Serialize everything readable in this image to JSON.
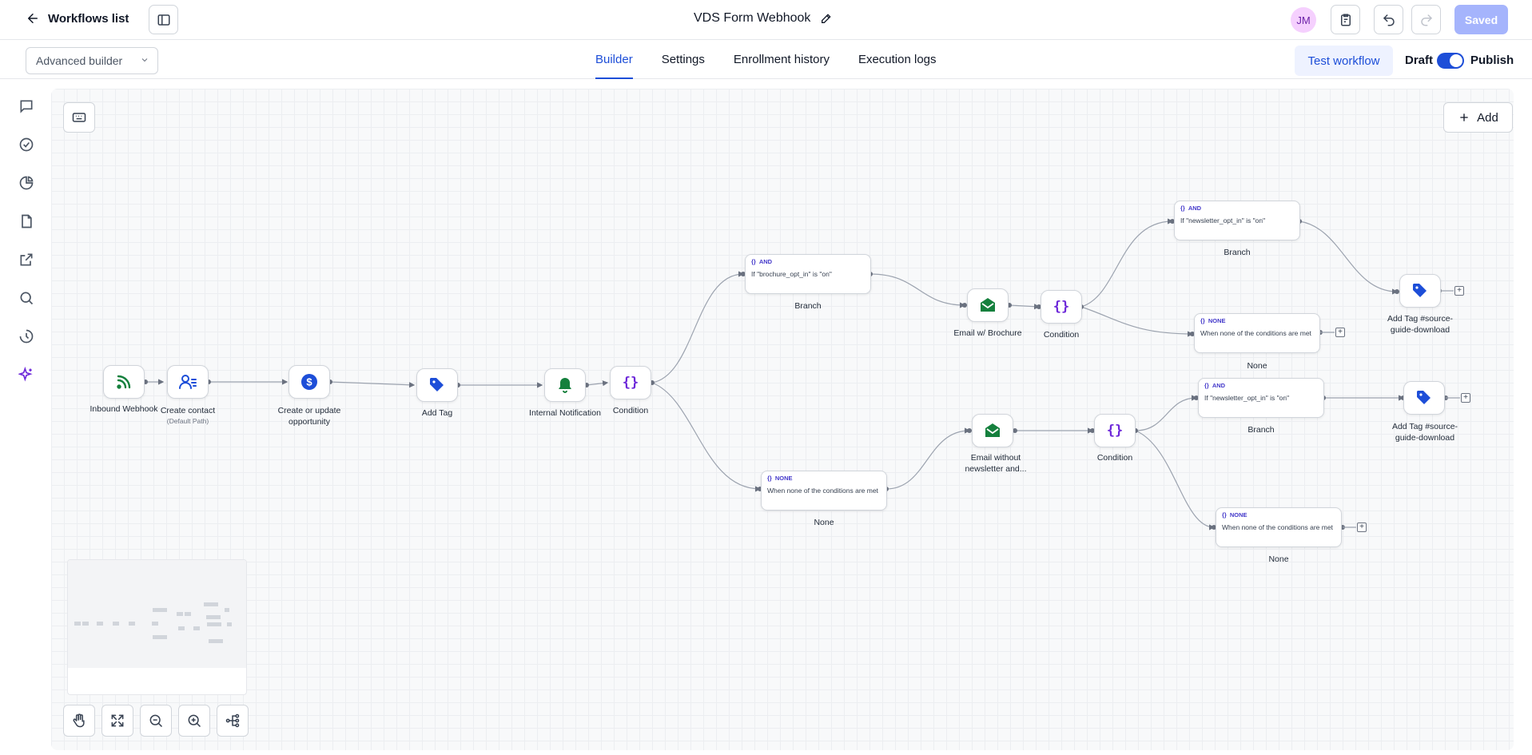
{
  "topbar": {
    "back_label": "Workflows list",
    "title": "VDS Form Webhook",
    "avatar_initials": "JM",
    "saved_label": "Saved"
  },
  "subbar": {
    "builder_mode": "Advanced builder",
    "tabs": [
      {
        "label": "Builder",
        "active": true
      },
      {
        "label": "Settings",
        "active": false
      },
      {
        "label": "Enrollment history",
        "active": false
      },
      {
        "label": "Execution logs",
        "active": false
      }
    ],
    "test_workflow_label": "Test workflow",
    "draft_label": "Draft",
    "publish_label": "Publish",
    "publish_toggle_on": true
  },
  "rail": {
    "icons": [
      "chat-icon",
      "check-circle-icon",
      "pie-chart-icon",
      "file-icon",
      "external-link-icon",
      "search-icon",
      "history-icon",
      "ai-sparkle-icon"
    ]
  },
  "canvas": {
    "add_label": "Add",
    "nodes": {
      "webhook": {
        "label": "Inbound Webhook"
      },
      "create_contact": {
        "label": "Create contact",
        "sub": "(Default Path)"
      },
      "opportunity": {
        "label": "Create or update opportunity"
      },
      "add_tag": {
        "label": "Add Tag"
      },
      "notification": {
        "label": "Internal Notification"
      },
      "condition1": {
        "label": "Condition"
      },
      "email_brochure": {
        "label": "Email w/ Brochure"
      },
      "condition2": {
        "label": "Condition"
      },
      "email_no_newsletter": {
        "label": "Email without newsletter and..."
      },
      "condition3": {
        "label": "Condition"
      },
      "add_tag_source1": {
        "label": "Add Tag #source-guide-download"
      },
      "add_tag_source2": {
        "label": "Add Tag #source-guide-download"
      }
    },
    "branches": {
      "brochure": {
        "type": "AND",
        "text": "If \"brochure_opt_in\" is \"on\"",
        "label": "Branch"
      },
      "none1": {
        "type": "NONE",
        "text": "When none of the conditions are met",
        "label": "None"
      },
      "newsletter1": {
        "type": "AND",
        "text": "If \"newsletter_opt_in\" is \"on\"",
        "label": "Branch"
      },
      "none2": {
        "type": "NONE",
        "text": "When none of the conditions are met",
        "label": "None"
      },
      "newsletter2": {
        "type": "AND",
        "text": "If \"newsletter_opt_in\" is \"on\"",
        "label": "Branch"
      },
      "none3": {
        "type": "NONE",
        "text": "When none of the conditions are met",
        "label": "None"
      }
    }
  },
  "colors": {
    "accent": "#1d4ed8",
    "trigger_green": "#15803d",
    "tag_blue": "#1d4ed8",
    "condition_purple": "#6d28d9"
  }
}
